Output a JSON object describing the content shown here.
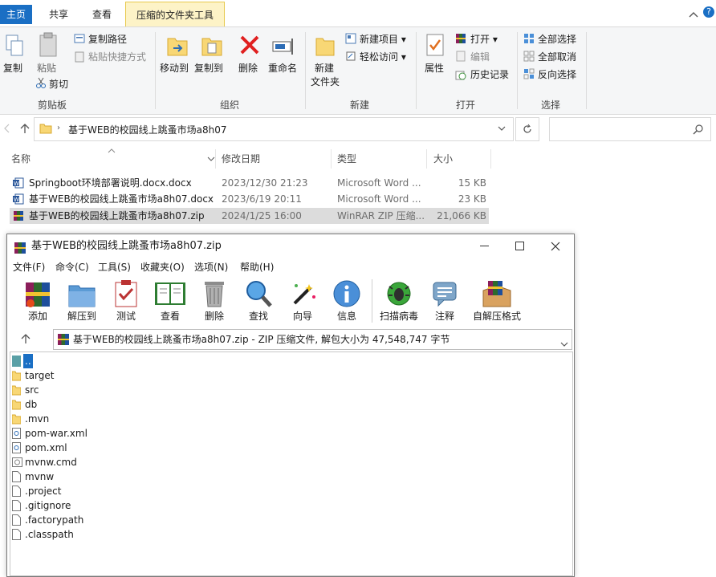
{
  "ribbon_tabs": [
    {
      "label": "主页"
    },
    {
      "label": "共享"
    },
    {
      "label": "查看"
    },
    {
      "label": "压缩的文件夹工具"
    }
  ],
  "ribbon": {
    "clipboard": {
      "copy": "复制",
      "paste": "粘贴",
      "copy_path": "复制路径",
      "paste_shortcut": "粘贴快捷方式",
      "cut": "剪切",
      "group": "剪贴板"
    },
    "organize": {
      "move_to": "移动到",
      "copy_to": "复制到",
      "delete": "删除",
      "rename": "重命名",
      "group": "组织"
    },
    "new": {
      "new_folder_line1": "新建",
      "new_folder_line2": "文件夹",
      "new_item": "新建项目",
      "easy_access": "轻松访问",
      "group": "新建"
    },
    "open": {
      "properties": "属性",
      "open": "打开",
      "edit": "编辑",
      "history": "历史记录",
      "group": "打开"
    },
    "select": {
      "select_all": "全部选择",
      "select_none": "全部取消",
      "invert": "反向选择",
      "group": "选择"
    }
  },
  "address": {
    "path": "基于WEB的校园线上跳蚤市场a8h07",
    "search_placeholder": ""
  },
  "columns": {
    "name": "名称",
    "modified": "修改日期",
    "type": "类型",
    "size": "大小"
  },
  "files": [
    {
      "name": "Springboot环境部署说明.docx.docx",
      "modified": "2023/12/30 21:23",
      "type": "Microsoft Word ...",
      "size": "15 KB",
      "icon": "word-icon"
    },
    {
      "name": "基于WEB的校园线上跳蚤市场a8h07.docx",
      "modified": "2023/6/19 20:11",
      "type": "Microsoft Word ...",
      "size": "23 KB",
      "icon": "word-icon"
    },
    {
      "name": "基于WEB的校园线上跳蚤市场a8h07.zip",
      "modified": "2024/1/25 16:00",
      "type": "WinRAR ZIP 压缩...",
      "size": "21,066 KB",
      "icon": "winrar-icon"
    }
  ],
  "winrar": {
    "title": "基于WEB的校园线上跳蚤市场a8h07.zip",
    "menu": [
      "文件(F)",
      "命令(C)",
      "工具(S)",
      "收藏夹(O)",
      "选项(N)",
      "帮助(H)"
    ],
    "toolbar": [
      "添加",
      "解压到",
      "测试",
      "查看",
      "删除",
      "查找",
      "向导",
      "信息",
      "扫描病毒",
      "注释",
      "自解压格式"
    ],
    "path_text": "基于WEB的校园线上跳蚤市场a8h07.zip - ZIP 压缩文件, 解包大小为 47,548,747 字节",
    "entries": [
      {
        "name": "..",
        "kind": "up"
      },
      {
        "name": "target",
        "kind": "folder"
      },
      {
        "name": "src",
        "kind": "folder"
      },
      {
        "name": "db",
        "kind": "folder"
      },
      {
        "name": ".mvn",
        "kind": "folder"
      },
      {
        "name": "pom-war.xml",
        "kind": "xml"
      },
      {
        "name": "pom.xml",
        "kind": "xml"
      },
      {
        "name": "mvnw.cmd",
        "kind": "cmd"
      },
      {
        "name": "mvnw",
        "kind": "file"
      },
      {
        "name": ".project",
        "kind": "file"
      },
      {
        "name": ".gitignore",
        "kind": "file"
      },
      {
        "name": ".factorypath",
        "kind": "file"
      },
      {
        "name": ".classpath",
        "kind": "file"
      }
    ]
  },
  "colors": {
    "tab_active": "#1a6fc4",
    "selection": "#dcdcdc",
    "context_tab": "#fdf3c7"
  }
}
